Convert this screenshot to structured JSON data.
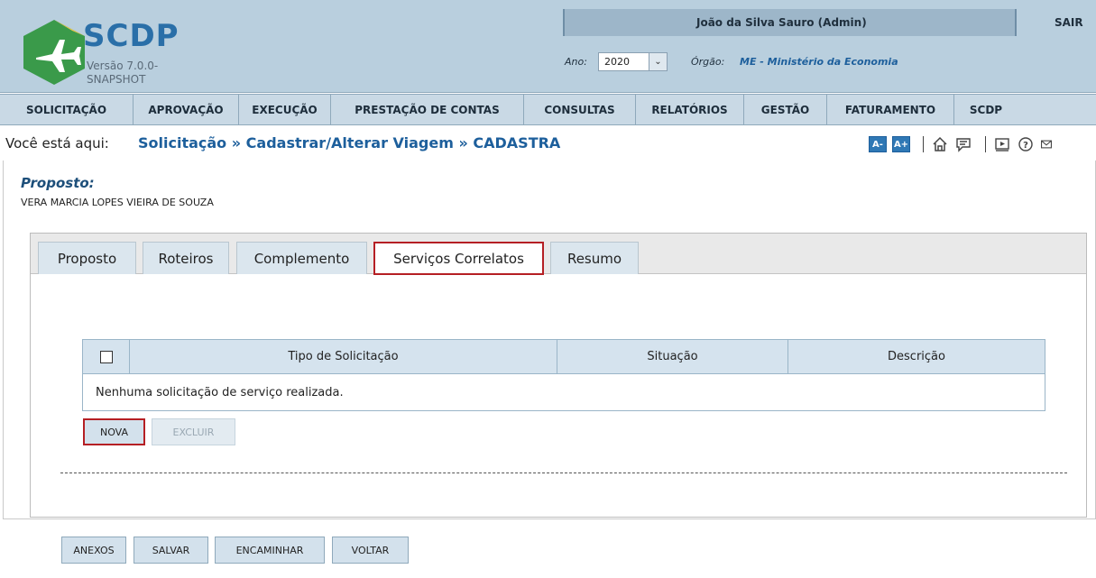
{
  "app": {
    "logo_text": "SCDP",
    "version": "Versão 7.0.0-SNAPSHOT"
  },
  "header": {
    "user": "João da Silva Sauro (Admin)",
    "logout": "SAIR",
    "ano_label": "Ano:",
    "ano_value": "2020",
    "orgao_label": "Órgão:",
    "orgao_value": "ME - Ministério da Economia"
  },
  "menu": {
    "items": [
      {
        "label": "SOLICITAÇÃO"
      },
      {
        "label": "APROVAÇÃO"
      },
      {
        "label": "EXECUÇÃO"
      },
      {
        "label": "PRESTAÇÃO DE CONTAS"
      },
      {
        "label": "CONSULTAS"
      },
      {
        "label": "RELATÓRIOS"
      },
      {
        "label": "GESTÃO"
      },
      {
        "label": "FATURAMENTO"
      },
      {
        "label": "SCDP"
      }
    ]
  },
  "breadcrumb": {
    "prefix": "Você está aqui:",
    "path": "Solicitação » Cadastrar/Alterar Viagem » CADASTRA"
  },
  "tools": {
    "font_decrease": "A-",
    "font_increase": "A+"
  },
  "proposto": {
    "label": "Proposto:",
    "name": "VERA MARCIA LOPES VIEIRA DE SOUZA"
  },
  "tabs": [
    {
      "label": "Proposto"
    },
    {
      "label": "Roteiros"
    },
    {
      "label": "Complemento"
    },
    {
      "label": "Serviços Correlatos",
      "active": true
    },
    {
      "label": "Resumo"
    }
  ],
  "grid": {
    "columns": [
      "Tipo de Solicitação",
      "Situação",
      "Descrição"
    ],
    "empty_message": "Nenhuma solicitação de serviço realizada."
  },
  "actions": {
    "nova": "NOVA",
    "excluir": "EXCLUIR"
  },
  "footer": {
    "anexos": "ANEXOS",
    "salvar": "SALVAR",
    "encaminhar": "ENCAMINHAR",
    "voltar": "VOLTAR"
  },
  "colors": {
    "header_bg": "#b9cfde",
    "accent_blue": "#1d5f9c",
    "highlight_red": "#b51f24",
    "logo_green": "#3a9a4a"
  }
}
